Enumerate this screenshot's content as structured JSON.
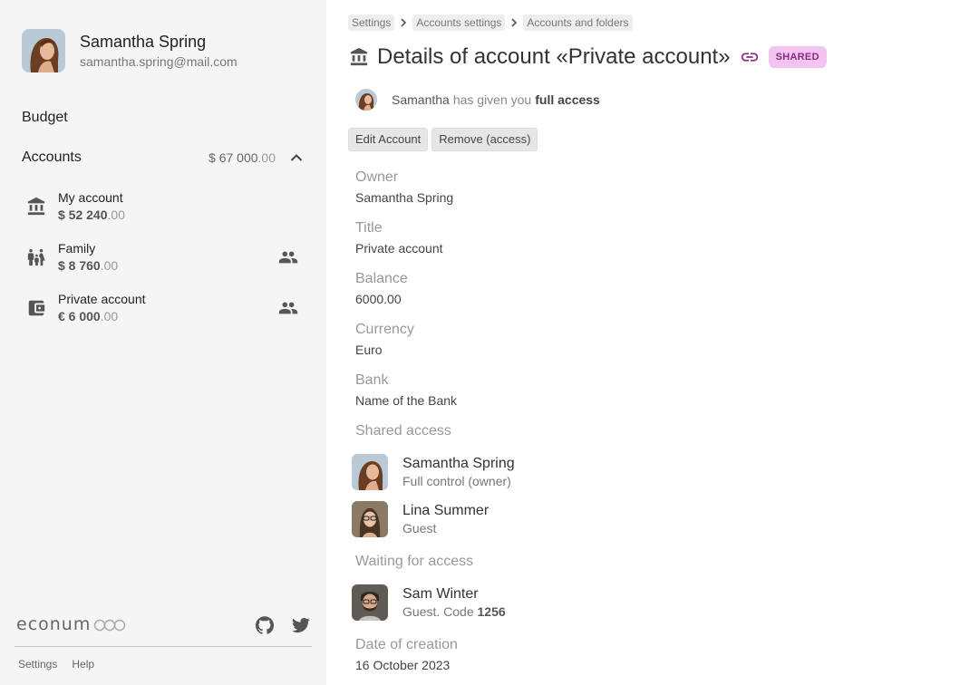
{
  "user": {
    "name": "Samantha Spring",
    "email": "samantha.spring@mail.com"
  },
  "nav": {
    "budget": "Budget",
    "accounts": "Accounts",
    "accounts_total_int": "$ 67 000",
    "accounts_total_dec": ".00"
  },
  "accounts": [
    {
      "name": "My account",
      "amount_int": "$ 52 240",
      "amount_dec": ".00",
      "icon": "bank-icon",
      "shared": false
    },
    {
      "name": "Family",
      "amount_int": "$ 8 760",
      "amount_dec": ".00",
      "icon": "family-icon",
      "shared": true
    },
    {
      "name": "Private account",
      "amount_int": "€ 6 000",
      "amount_dec": ".00",
      "icon": "wallet-icon",
      "shared": true
    }
  ],
  "footer": {
    "logo": "econum",
    "settings": "Settings",
    "help": "Help"
  },
  "breadcrumbs": [
    "Settings",
    "Accounts settings",
    "Accounts and folders"
  ],
  "page": {
    "title": "Details of account «Private account»",
    "badge": "SHARED"
  },
  "access_note": {
    "name": "Samantha",
    "text": "has given you",
    "level": "full access"
  },
  "buttons": {
    "edit": "Edit Account",
    "remove": "Remove (access)"
  },
  "fields": [
    {
      "label": "Owner",
      "value": "Samantha Spring"
    },
    {
      "label": "Title",
      "value": "Private account"
    },
    {
      "label": "Balance",
      "value": "6000.00"
    },
    {
      "label": "Currency",
      "value": "Euro"
    },
    {
      "label": "Bank",
      "value": "Name of the Bank"
    }
  ],
  "shared_access": {
    "label": "Shared access",
    "people": [
      {
        "name": "Samantha Spring",
        "role": "Full control (owner)"
      },
      {
        "name": "Lina Summer",
        "role": "Guest"
      }
    ]
  },
  "waiting": {
    "label": "Waiting for access",
    "people": [
      {
        "name": "Sam Winter",
        "role": "Guest. Code",
        "code": "1256"
      }
    ]
  },
  "created": {
    "label": "Date of creation",
    "value": "16 October 2023"
  },
  "colors": {
    "sidebar_bg": "#f5f5f5",
    "badge_bg": "#f3c4f0",
    "badge_text": "#8a2b86"
  }
}
